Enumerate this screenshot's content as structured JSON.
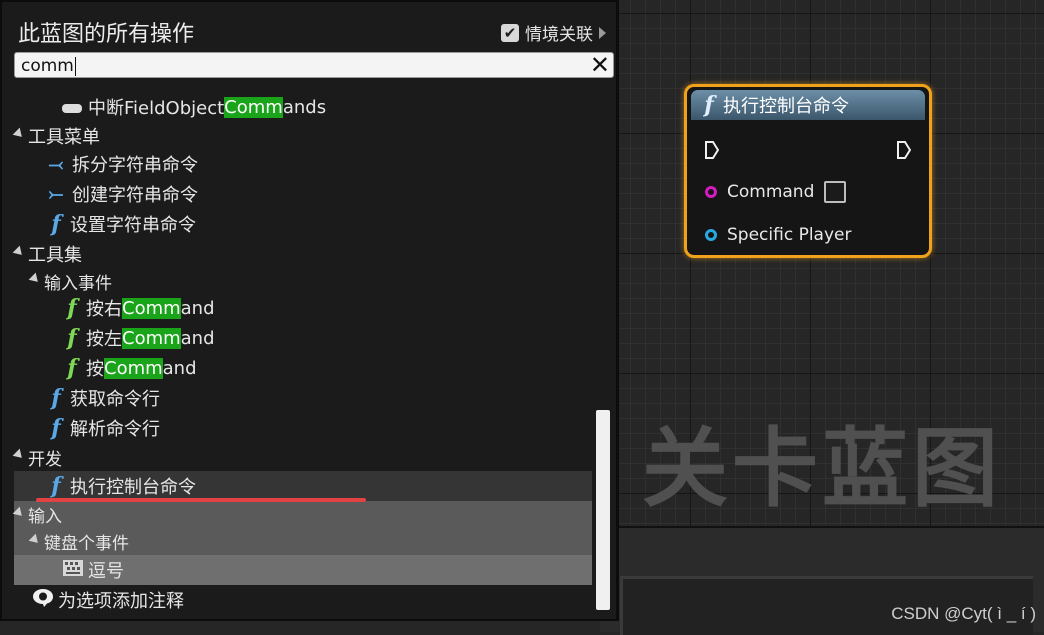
{
  "panel": {
    "title": "此蓝图的所有操作",
    "context_label": "情境关联",
    "context_checked": "✔",
    "search": {
      "value": "comm"
    }
  },
  "list": {
    "row0": {
      "pre": "中断FieldObject",
      "hl": "Comm",
      "post": "ands"
    },
    "cat_tools_menu": "工具菜单",
    "split_string_cmd": "拆分字符串命令",
    "create_string_cmd": "创建字符串命令",
    "set_string_cmd": "设置字符串命令",
    "cat_toolset": "工具集",
    "cat_input_events": "输入事件",
    "press_right": {
      "pre": "按右",
      "hl": "Comm",
      "post": "and"
    },
    "press_left": {
      "pre": "按左",
      "hl": "Comm",
      "post": "and"
    },
    "press": {
      "pre": "按",
      "hl": "Comm",
      "post": "and"
    },
    "get_cmdline": "获取命令行",
    "parse_cmdline": "解析命令行",
    "cat_dev": "开发",
    "exec_console_cmd": "执行控制台命令",
    "cat_input": "输入",
    "cat_keyboard_events": "键盘个事件",
    "comma": "逗号",
    "add_comment": "为选项添加注释"
  },
  "node": {
    "title": "执行控制台命令",
    "pin_command": "Command",
    "pin_player": "Specific Player"
  },
  "graph": {
    "watermark": "关卡蓝图"
  },
  "footer": {
    "credit": "CSDN @Cyt( ì _ í )"
  },
  "colors": {
    "highlight": "#19a419",
    "node_border": "#f0a21c",
    "pin_command": "#d21cc0",
    "pin_player": "#2aa8e0"
  }
}
